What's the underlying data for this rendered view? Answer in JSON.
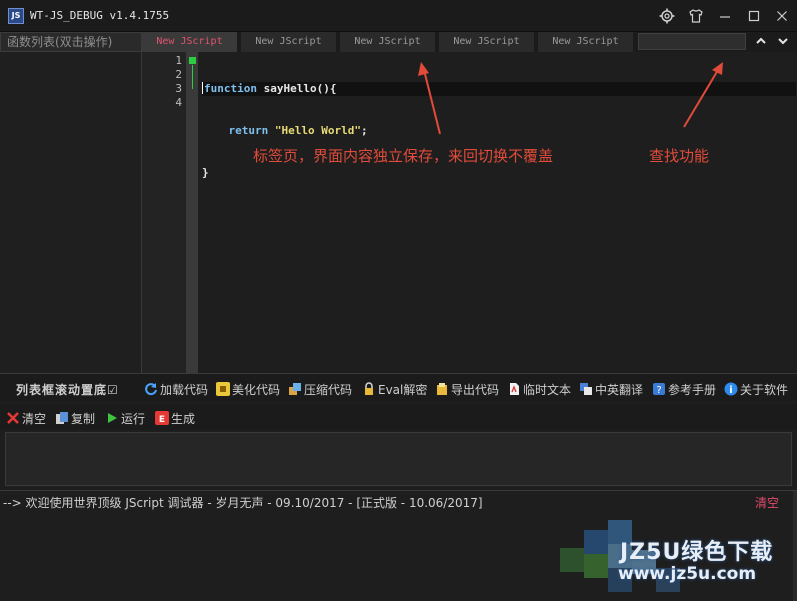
{
  "window": {
    "logo_text": "JS",
    "title": "WT-JS_DEBUG v1.4.1755",
    "controls": [
      "settings-icon",
      "shirt-icon",
      "minimize-icon",
      "maximize-icon",
      "close-icon"
    ]
  },
  "function_list": {
    "header": "函数列表(双击操作)"
  },
  "tabs": [
    {
      "label": "New JScript",
      "active": true
    },
    {
      "label": "New JScript",
      "active": false
    },
    {
      "label": "New JScript",
      "active": false
    },
    {
      "label": "New JScript",
      "active": false
    },
    {
      "label": "New JScript",
      "active": false
    }
  ],
  "find": {
    "value": "",
    "up_icon": "chevron-up-icon",
    "down_icon": "chevron-down-icon"
  },
  "editor": {
    "line_numbers": [
      "1",
      "2",
      "3",
      "4"
    ],
    "code": {
      "l1_kw": "function",
      "l1_rest": " sayHello(){",
      "l2_indent": "    ",
      "l2_kw": "return",
      "l2_space": " ",
      "l2_str": "\"Hello World\"",
      "l2_end": ";",
      "l3": "}",
      "l4": ""
    }
  },
  "annotations": {
    "tabs_note": "标签页，界面内容独立保存，来回切换不覆盖",
    "find_note": "查找功能",
    "color": "#e04b3a"
  },
  "toolbar1": {
    "scroll_checkbox": "列表框滚动置底☑",
    "items": [
      {
        "label": "加载代码",
        "icon": "reload-icon"
      },
      {
        "label": "美化代码",
        "icon": "beautify-icon"
      },
      {
        "label": "压缩代码",
        "icon": "compress-icon"
      },
      {
        "label": "Eval解密",
        "icon": "lock-icon"
      },
      {
        "label": "导出代码",
        "icon": "export-icon"
      },
      {
        "label": "临时文本",
        "icon": "document-icon"
      },
      {
        "label": "中英翻译",
        "icon": "translate-icon"
      },
      {
        "label": "参考手册",
        "icon": "help-icon"
      },
      {
        "label": "关于软件",
        "icon": "info-icon"
      }
    ]
  },
  "toolbar2": {
    "items": [
      {
        "label": "清空",
        "icon": "clear-icon"
      },
      {
        "label": "复制",
        "icon": "copy-icon"
      },
      {
        "label": "运行",
        "icon": "run-icon"
      },
      {
        "label": "生成",
        "icon": "generate-icon"
      }
    ]
  },
  "log": {
    "message": "--> 欢迎使用世界顶级 JScript 调试器 - 岁月无声 - 09.10/2017 - [正式版 - 10.06/2017]",
    "clear_label": "清空"
  },
  "watermark": {
    "brand": "JZ5U绿色下载",
    "url": "www.jz5u.com"
  },
  "colors": {
    "accent_tab": "#e0556f",
    "keyword": "#7ec0ee",
    "string": "#e6db74",
    "fold_marker": "#2ecc40"
  }
}
